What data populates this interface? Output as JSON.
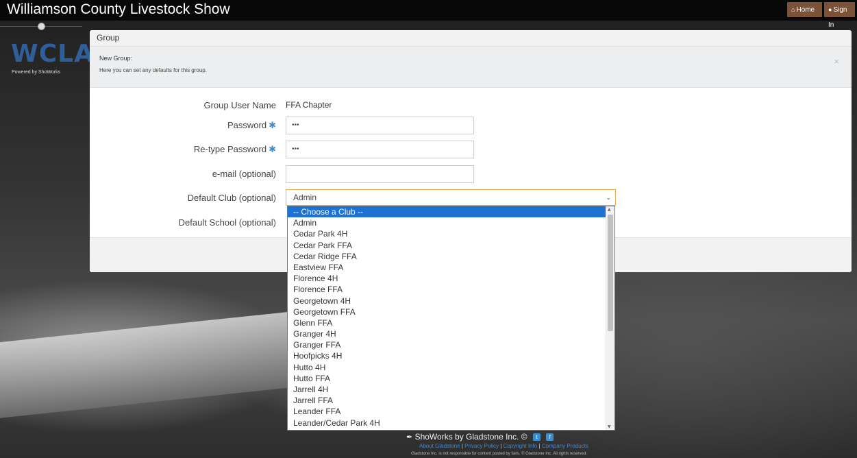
{
  "site": {
    "title": "Williamson County Livestock Show"
  },
  "nav": {
    "home": "Home",
    "sign_in": "Sign In"
  },
  "logo": {
    "text": "WCLA",
    "sub": "Powered by ShoWorks"
  },
  "panel": {
    "header": "Group"
  },
  "notice": {
    "title": "New Group:",
    "body": "Here you can set any defaults for this group.",
    "close": "×"
  },
  "form": {
    "group_user_name_label": "Group User Name",
    "group_user_name_value": "FFA Chapter",
    "password_label": "Password",
    "password_value": "•••",
    "retype_password_label": "Re-type Password",
    "retype_password_value": "•••",
    "email_label": "e-mail (optional)",
    "email_value": "",
    "default_club_label": "Default Club (optional)",
    "default_club_value": "Admin",
    "default_school_label": "Default School (optional)",
    "required_mark": "✱"
  },
  "club_options": [
    "-- Choose a Club --",
    "Admin",
    "Cedar Park 4H",
    "Cedar Park FFA",
    "Cedar Ridge FFA",
    "Eastview FFA",
    "Florence 4H",
    "Florence FFA",
    "Georgetown 4H",
    "Georgetown FFA",
    "Glenn FFA",
    "Granger 4H",
    "Granger FFA",
    "Hoofpicks 4H",
    "Hutto 4H",
    "Hutto FFA",
    "Jarrell 4H",
    "Jarrell FFA",
    "Leander FFA",
    "Leander/Cedar Park 4H"
  ],
  "highlighted_option_index": 0,
  "footer": {
    "brand": "ShoWorks by Gladstone Inc. ©",
    "links": [
      "About Gladstone",
      "Privacy Policy",
      "Copyright Info",
      "Company Products"
    ],
    "note": "Gladstone Inc. is not responsible for content posted by fairs. © Gladstone Inc. All rights reserved."
  },
  "colors": {
    "accent": "#7b5138",
    "highlight": "#1e72d6",
    "focus": "#f0ad4e",
    "required": "#3b8fd1"
  }
}
